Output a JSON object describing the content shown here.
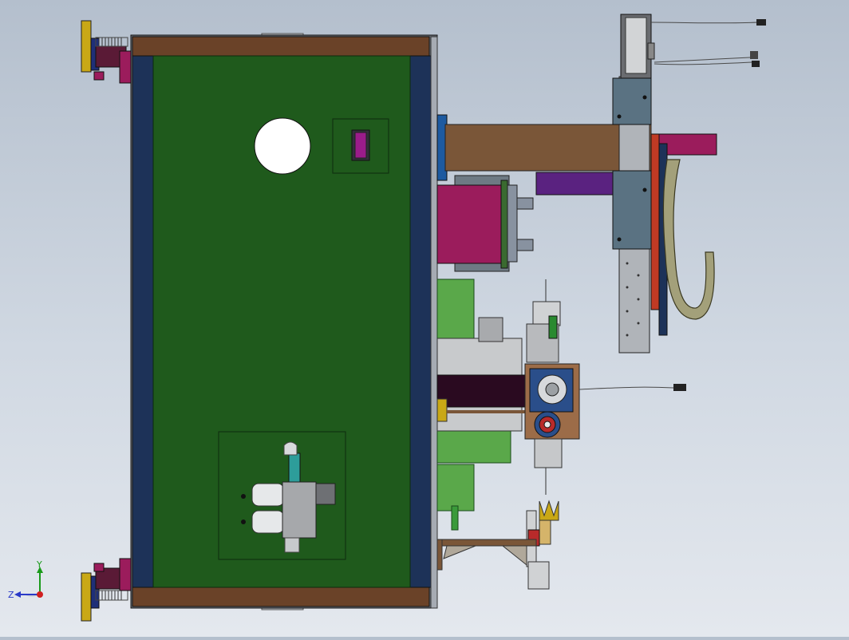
{
  "viewport": {
    "background_top": "#b4bfcd",
    "background_bottom": "#e4e8ee"
  },
  "colors": {
    "base_plate": "#1f5a1c",
    "frame_blue": "#1d3258",
    "top_bar_brown": "#6a4228",
    "arm_brown": "#7a5638",
    "magenta": "#9b1c5c",
    "purple": "#5a2280",
    "steel": "#6a7d88",
    "hook_olive": "#a3a07a",
    "wire": "#4a4a4a",
    "accent_yellow": "#c9a816"
  },
  "triad": {
    "x_label": "",
    "y_label": "Y",
    "z_label": "Z"
  },
  "parts": [
    "adjustable-foot-top",
    "adjustable-foot-bottom",
    "base-plate",
    "mounting-hole",
    "connector-block",
    "air-filter-regulator",
    "linear-axis-slide",
    "servo-motor",
    "arm-beam",
    "hook-bracket",
    "clamp-cylinder",
    "gripper-assembly",
    "gearbox-housing",
    "rotary-table"
  ]
}
